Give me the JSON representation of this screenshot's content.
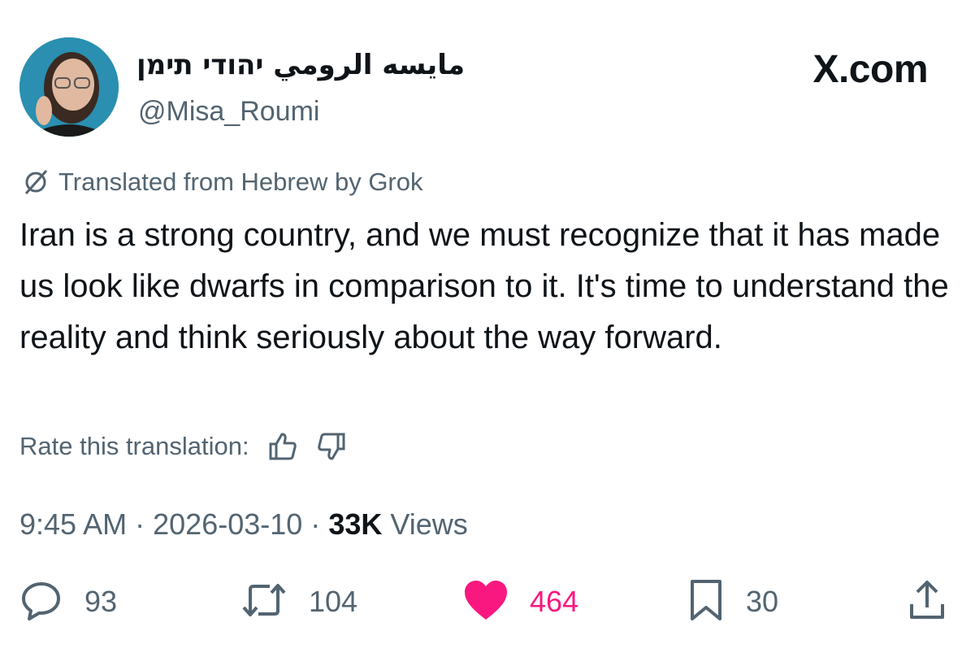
{
  "author": {
    "display_name": "مايسه الرومي יהודי תימן",
    "handle": "@Misa_Roumi"
  },
  "brand": "X.com",
  "translation": {
    "label": "Translated from Hebrew by Grok",
    "rate_label": "Rate this translation:"
  },
  "tweet": {
    "text": "Iran is a strong country, and we must recognize that it has made us look like dwarfs in comparison to it. It's time to understand the reality and think seriously about the way forward."
  },
  "meta": {
    "time": "9:45 AM",
    "separator": "·",
    "date": "2026-03-10",
    "views_count": "33K",
    "views_label": "Views"
  },
  "actions": {
    "replies": "93",
    "reposts": "104",
    "likes": "464",
    "bookmarks": "30"
  },
  "icons": {
    "translate": "globe-slash-icon",
    "thumbs_up": "thumbs-up-icon",
    "thumbs_down": "thumbs-down-icon",
    "reply": "reply-icon",
    "repost": "repost-icon",
    "like": "heart-icon",
    "bookmark": "bookmark-icon",
    "share": "share-icon"
  },
  "colors": {
    "text": "#0f1419",
    "secondary": "#536471",
    "like": "#f91880"
  }
}
